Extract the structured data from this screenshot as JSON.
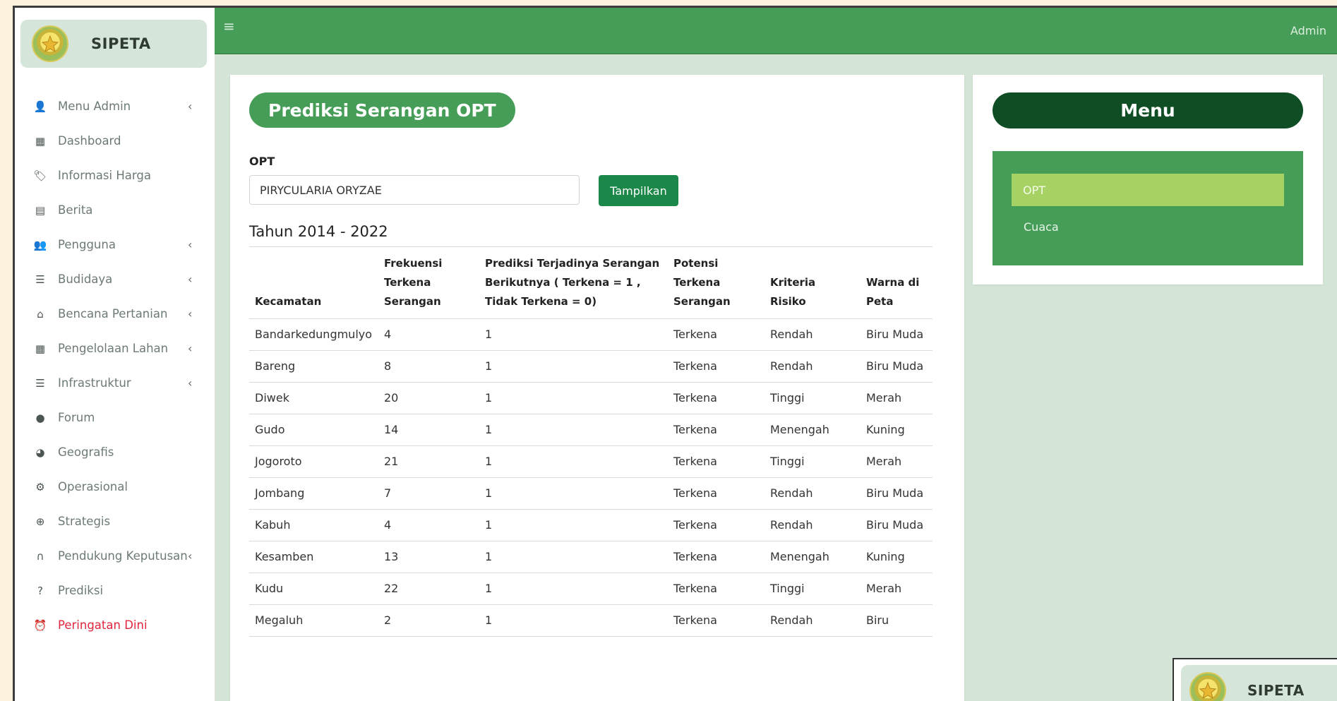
{
  "brand": {
    "name": "SIPETA"
  },
  "sidebar": {
    "items": [
      {
        "label": "Menu Admin",
        "icon": "user-icon",
        "glyph": "👤",
        "has_chevron": true,
        "name": "sidebar-item-menu-admin"
      },
      {
        "label": "Dashboard",
        "icon": "grid-icon",
        "glyph": "▦",
        "has_chevron": false,
        "name": "sidebar-item-dashboard"
      },
      {
        "label": "Informasi Harga",
        "icon": "price-tag-icon",
        "glyph": "🏷",
        "has_chevron": false,
        "name": "sidebar-item-informasi-harga"
      },
      {
        "label": "Berita",
        "icon": "newspaper-icon",
        "glyph": "▤",
        "has_chevron": false,
        "name": "sidebar-item-berita"
      },
      {
        "label": "Pengguna",
        "icon": "users-icon",
        "glyph": "👥",
        "has_chevron": true,
        "name": "sidebar-item-pengguna"
      },
      {
        "label": "Budidaya",
        "icon": "plant-icon",
        "glyph": "☰",
        "has_chevron": true,
        "name": "sidebar-item-budidaya"
      },
      {
        "label": "Bencana Pertanian",
        "icon": "home-icon",
        "glyph": "⌂",
        "has_chevron": true,
        "name": "sidebar-item-bencana-pertanian"
      },
      {
        "label": "Pengelolaan Lahan",
        "icon": "table-icon",
        "glyph": "▦",
        "has_chevron": true,
        "name": "sidebar-item-pengelolaan-lahan"
      },
      {
        "label": "Infrastruktur",
        "icon": "building-icon",
        "glyph": "☰",
        "has_chevron": true,
        "name": "sidebar-item-infrastruktur"
      },
      {
        "label": "Forum",
        "icon": "chat-icon",
        "glyph": "●",
        "has_chevron": false,
        "name": "sidebar-item-forum"
      },
      {
        "label": "Geografis",
        "icon": "globe-icon",
        "glyph": "◕",
        "has_chevron": false,
        "name": "sidebar-item-geografis"
      },
      {
        "label": "Operasional",
        "icon": "gears-icon",
        "glyph": "⚙",
        "has_chevron": false,
        "name": "sidebar-item-operasional"
      },
      {
        "label": "Strategis",
        "icon": "target-icon",
        "glyph": "⊕",
        "has_chevron": false,
        "name": "sidebar-item-strategis"
      },
      {
        "label": "Pendukung Keputusan",
        "icon": "headset-icon",
        "glyph": "∩",
        "has_chevron": true,
        "name": "sidebar-item-pendukung-keputusan"
      },
      {
        "label": "Prediksi",
        "icon": "question-icon",
        "glyph": "?",
        "has_chevron": false,
        "name": "sidebar-item-prediksi"
      },
      {
        "label": "Peringatan Dini",
        "icon": "alarm-icon",
        "glyph": "⏰",
        "has_chevron": false,
        "alert": true,
        "name": "sidebar-item-peringatan-dini"
      }
    ],
    "chevron_glyph": "‹"
  },
  "topbar": {
    "menu_glyph": "≡",
    "user": "Admin"
  },
  "main": {
    "title": "Prediksi Serangan OPT",
    "opt_label": "OPT",
    "opt_value": "PIRYCULARIA ORYZAE",
    "show_button": "Tampilkan",
    "year_range": "Tahun 2014 - 2022",
    "table": {
      "columns": [
        "Kecamatan",
        "Frekuensi Terkena Serangan",
        "Prediksi Terjadinya Serangan Berikutnya ( Terkena = 1 , Tidak Terkena = 0)",
        "Potensi Terkena Serangan",
        "Kriteria Risiko",
        "Warna di Peta"
      ],
      "rows": [
        [
          "Bandarkedungmulyo",
          "4",
          "1",
          "Terkena",
          "Rendah",
          "Biru Muda"
        ],
        [
          "Bareng",
          "8",
          "1",
          "Terkena",
          "Rendah",
          "Biru Muda"
        ],
        [
          "Diwek",
          "20",
          "1",
          "Terkena",
          "Tinggi",
          "Merah"
        ],
        [
          "Gudo",
          "14",
          "1",
          "Terkena",
          "Menengah",
          "Kuning"
        ],
        [
          "Jogoroto",
          "21",
          "1",
          "Terkena",
          "Tinggi",
          "Merah"
        ],
        [
          "Jombang",
          "7",
          "1",
          "Terkena",
          "Rendah",
          "Biru Muda"
        ],
        [
          "Kabuh",
          "4",
          "1",
          "Terkena",
          "Rendah",
          "Biru Muda"
        ],
        [
          "Kesamben",
          "13",
          "1",
          "Terkena",
          "Menengah",
          "Kuning"
        ],
        [
          "Kudu",
          "22",
          "1",
          "Terkena",
          "Tinggi",
          "Merah"
        ],
        [
          "Megaluh",
          "2",
          "1",
          "Terkena",
          "Rendah",
          "Biru"
        ]
      ]
    }
  },
  "side_menu": {
    "title": "Menu",
    "items": [
      "OPT",
      "Cuaca"
    ]
  },
  "colors": {
    "primary_green": "#469d58",
    "dark_green": "#0f4d24",
    "button_green": "#1b8849",
    "light_green": "#a6d163",
    "alert_red": "#e0253d"
  }
}
